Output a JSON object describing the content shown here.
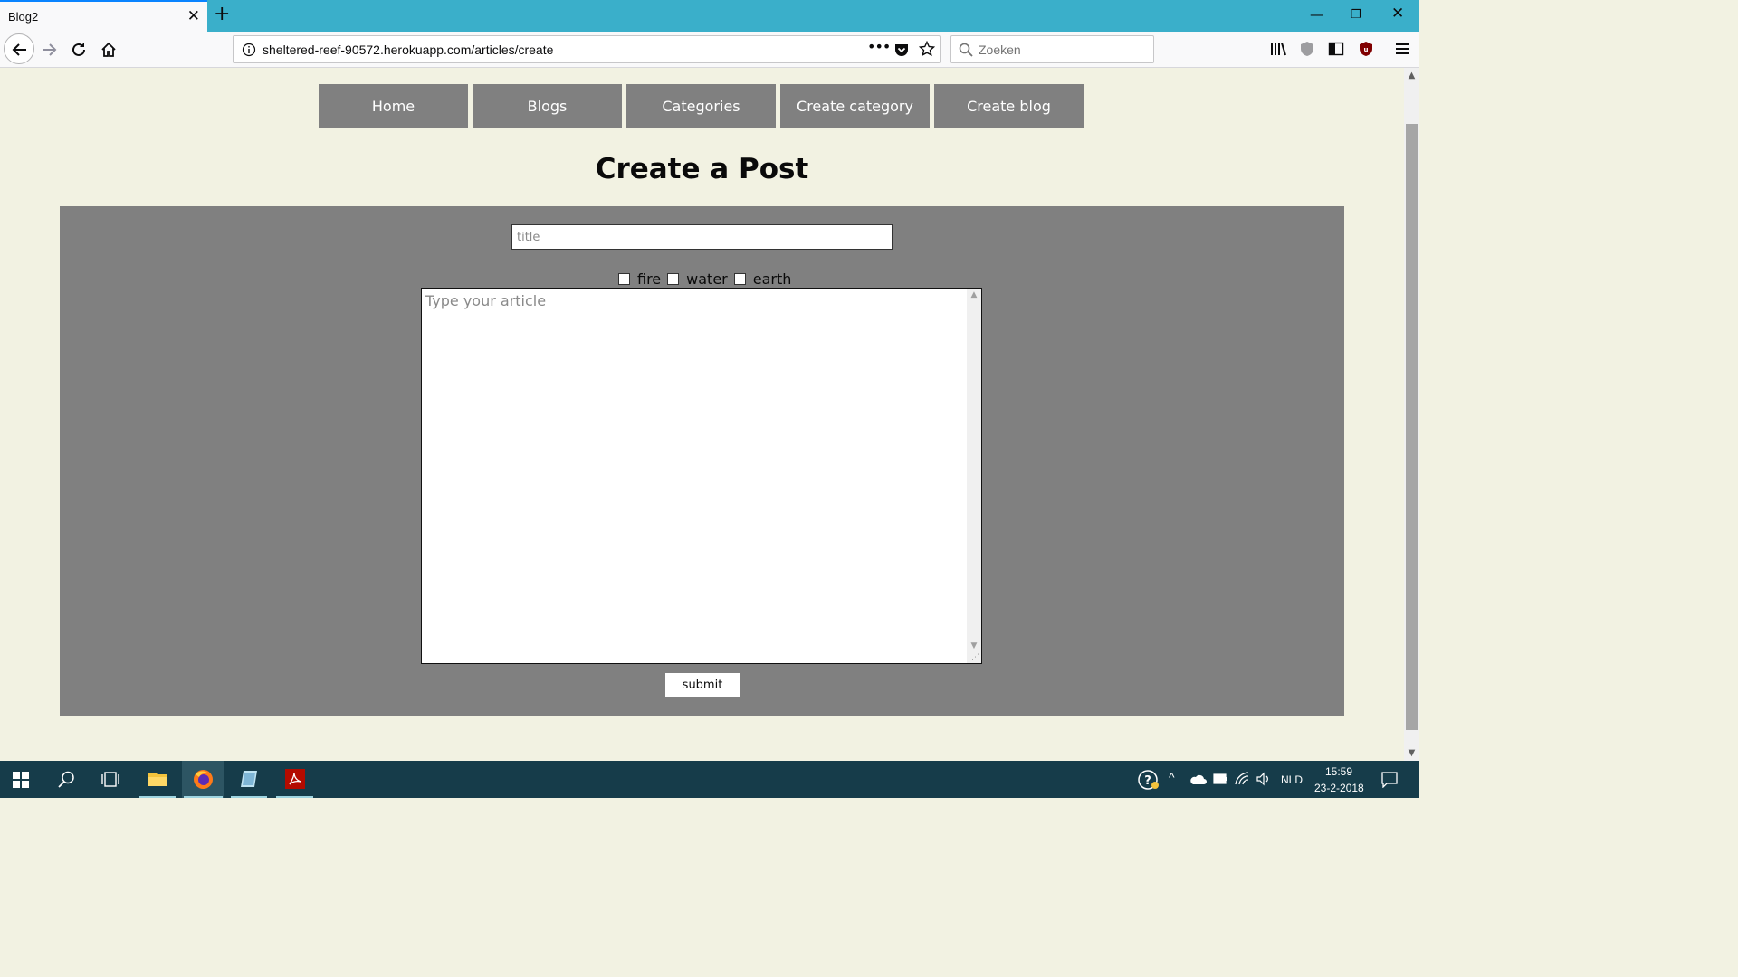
{
  "browser": {
    "tab_title": "Blog2",
    "url": "sheltered-reef-90572.herokuapp.com/articles/create",
    "search_placeholder": "Zoeken"
  },
  "site_nav": {
    "items": [
      "Home",
      "Blogs",
      "Categories",
      "Create category",
      "Create blog"
    ]
  },
  "page": {
    "heading": "Create a Post",
    "title_placeholder": "title",
    "categories": [
      "fire",
      "water",
      "earth"
    ],
    "article_placeholder": "Type your article",
    "submit_label": "submit"
  },
  "taskbar": {
    "language": "NLD",
    "time": "15:59",
    "date": "23-2-2018"
  },
  "colors": {
    "page_bg": "#f2f2e2",
    "nav_button_bg": "#808080",
    "form_bg": "#808080",
    "tabbar_bg": "#3aafca",
    "taskbar_bg": "#163c4a"
  }
}
